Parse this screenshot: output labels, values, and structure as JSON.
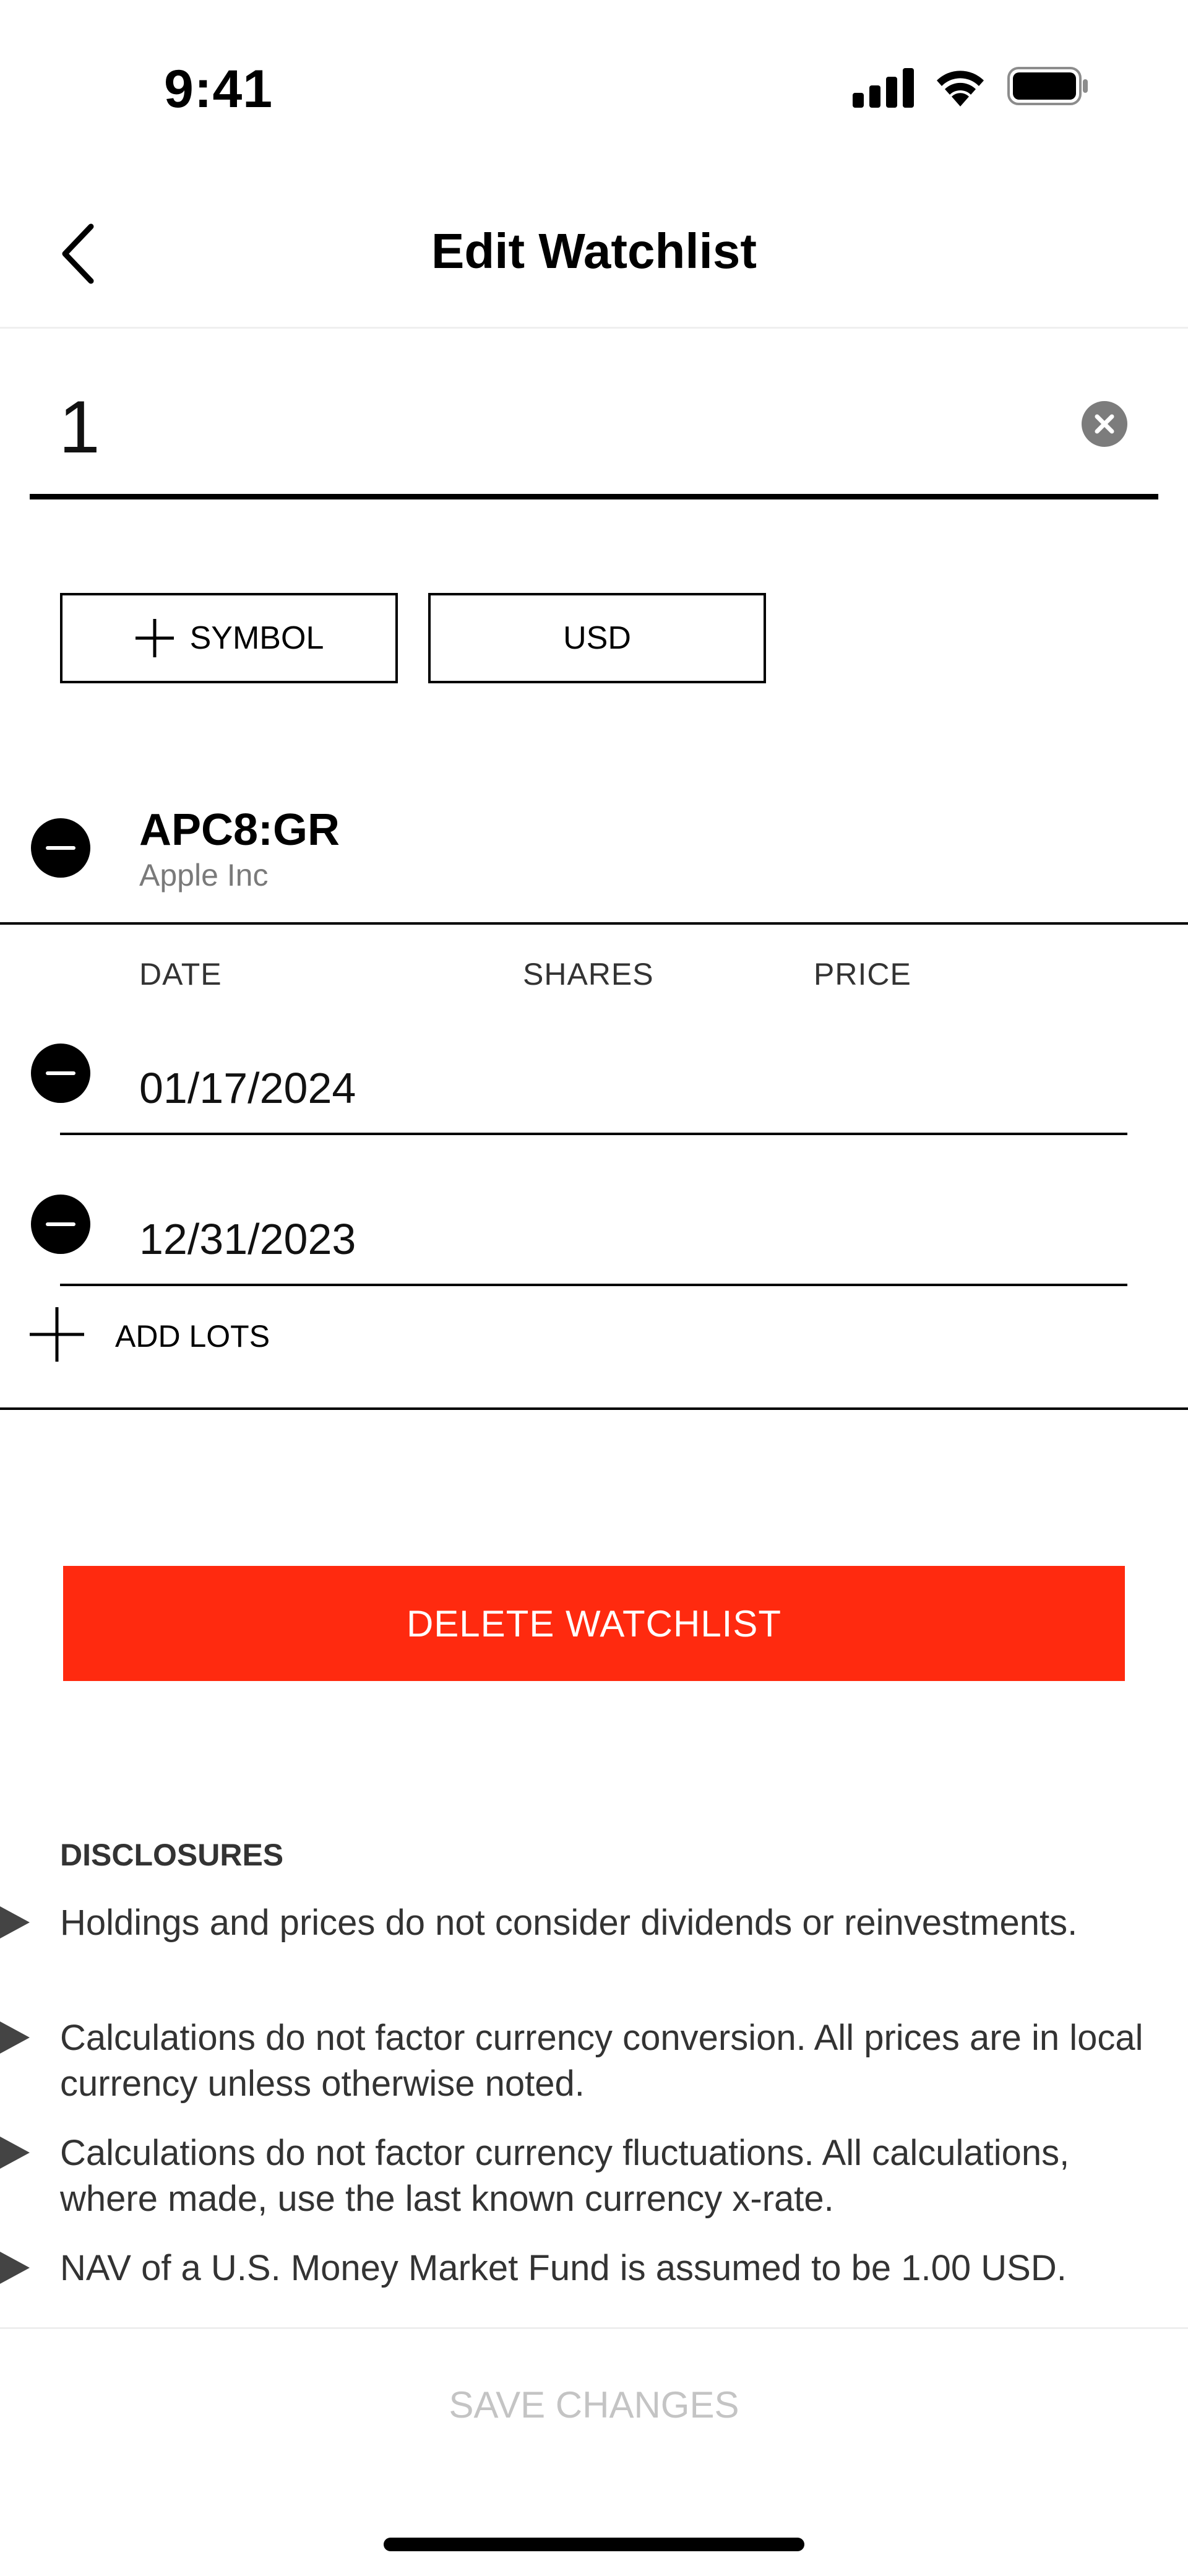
{
  "status_bar": {
    "time": "9:41"
  },
  "header": {
    "title": "Edit Watchlist"
  },
  "watchlist_name": {
    "value": "1"
  },
  "buttons": {
    "add_symbol": "SYMBOL",
    "currency": "USD"
  },
  "holding": {
    "ticker": "APC8:GR",
    "company": "Apple Inc",
    "columns": [
      "DATE",
      "SHARES",
      "PRICE"
    ],
    "lots": [
      {
        "date": "01/17/2024"
      },
      {
        "date": "12/31/2023"
      }
    ],
    "add_lots": "ADD LOTS"
  },
  "delete_button": "DELETE WATCHLIST",
  "disclosures": {
    "title": "DISCLOSURES",
    "items": [
      "Holdings and prices do not consider dividends or reinvestments.",
      "Calculations do not factor currency conversion. All prices are in local currency unless otherwise noted.",
      "Calculations do not factor currency fluctuations. All calculations, where made, use the last known currency x-rate.",
      "NAV of a U.S. Money Market Fund is assumed to be 1.00 USD."
    ]
  },
  "save_button": "SAVE CHANGES",
  "colors": {
    "accent_red": "#ff2a0f",
    "disabled_text": "#c4c4c4"
  }
}
